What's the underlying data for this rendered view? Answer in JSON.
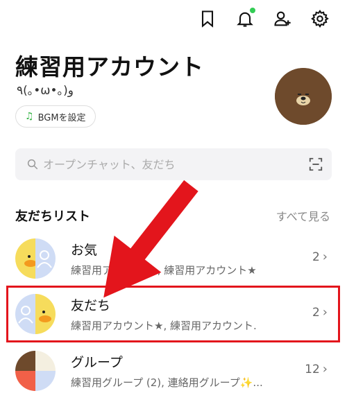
{
  "header": {
    "icons": [
      "bookmark-icon",
      "bell-icon",
      "add-friend-icon",
      "gear-icon"
    ],
    "notification_dot_color": "#33cc55"
  },
  "profile": {
    "name": "練習用アカウント",
    "status": "٩(｡•ω•｡)و",
    "bgm_label": "BGMを設定"
  },
  "search": {
    "placeholder": "オープンチャット、友だち"
  },
  "friends_section": {
    "title": "友だちリスト",
    "see_all": "すべて見る",
    "rows": [
      {
        "title": "お気",
        "subtitle": "練習用アカウント., 練習用アカウント★",
        "count": "2"
      },
      {
        "title": "友だち",
        "subtitle": "練習用アカウント★, 練習用アカウント.",
        "count": "2"
      },
      {
        "title": "グループ",
        "subtitle": "練習用グループ (2), 連絡用グループ✨...",
        "count": "12"
      }
    ]
  },
  "annotation": {
    "highlight_color": "#e3151c",
    "arrow_color": "#e3151c"
  }
}
